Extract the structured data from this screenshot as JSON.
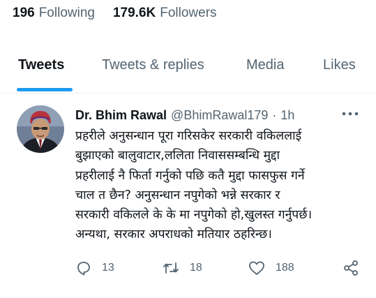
{
  "profile_stats": {
    "following_count": "196",
    "following_label": "Following",
    "followers_count": "179.6K",
    "followers_label": "Followers"
  },
  "tabs": [
    {
      "label": "Tweets",
      "active": true
    },
    {
      "label": "Tweets & replies",
      "active": false
    },
    {
      "label": "Media",
      "active": false
    },
    {
      "label": "Likes",
      "active": false
    }
  ],
  "tweet": {
    "author_name": "Dr. Bhim Rawal",
    "handle": "@BhimRawal179",
    "separator": "·",
    "time": "1h",
    "more_icon": "more-horizontal-icon",
    "text_lines": [
      "प्रहरीले अनुसन्धान पूरा गरिसकेर सरकारी वकिललाई",
      "बुझाएको बालुवाटार,ललिता निवाससम्बन्धि मुद्दा",
      "प्रहरीलाई नै फिर्ता गर्नुको पछि कतै मुद्दा फासफुस गर्ने",
      "चाल त छैन? अनुसन्धान नपुगेको भन्ने सरकार र",
      "सरकारी वकिलले के के मा नपुगेको हो,खुलस्त गर्नुपर्छ।",
      "अन्यथा, सरकार अपराधको मतियार ठहरिन्छ।"
    ],
    "actions": {
      "reply_icon": "reply-icon",
      "reply_count": "13",
      "retweet_icon": "retweet-icon",
      "retweet_count": "18",
      "like_icon": "heart-icon",
      "like_count": "188",
      "share_icon": "share-icon"
    }
  },
  "colors": {
    "accent": "#1d9bf0",
    "text_primary": "#0f1419",
    "text_secondary": "#536471",
    "divider": "#eff3f4"
  }
}
